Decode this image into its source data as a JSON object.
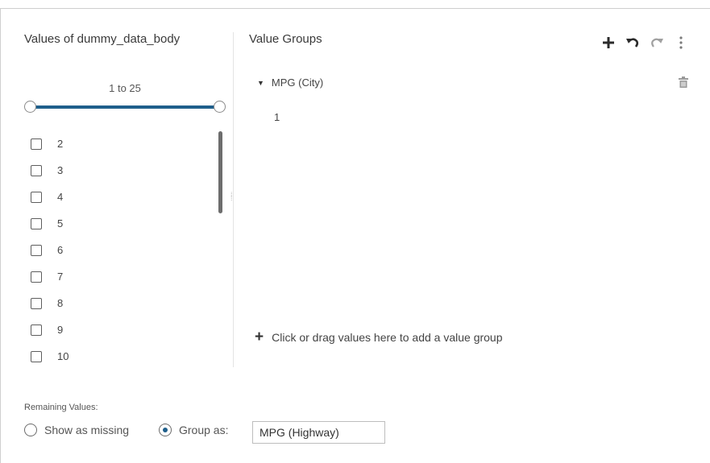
{
  "left_panel": {
    "title": "Values of dummy_data_body",
    "range_label": "1 to 25",
    "values": [
      "2",
      "3",
      "4",
      "5",
      "6",
      "7",
      "8",
      "9",
      "10"
    ]
  },
  "right_panel": {
    "title": "Value Groups",
    "toolbar": {
      "add_icon": "plus-icon",
      "undo_icon": "undo-icon",
      "redo_icon": "redo-icon",
      "more_icon": "vertical-dots-icon"
    },
    "group": {
      "name": "MPG (City)",
      "values": [
        "1"
      ]
    },
    "add_hint": "Click or drag values here to add a value group"
  },
  "remaining": {
    "label": "Remaining Values:",
    "show_missing_label": "Show as missing",
    "group_as_label": "Group as:",
    "group_as_value": "MPG (Highway)",
    "selected_option": "group_as"
  },
  "colors": {
    "accent": "#1f5f8b"
  }
}
